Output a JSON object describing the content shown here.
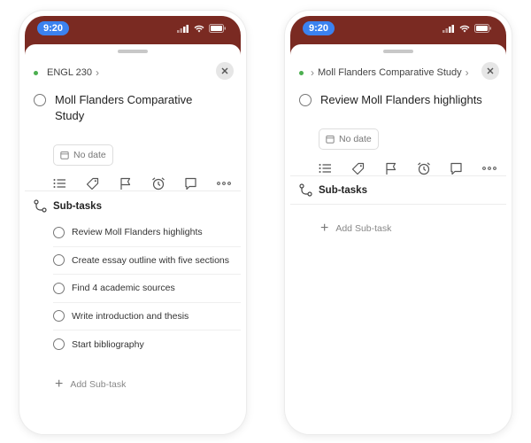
{
  "status_bar": {
    "time": "9:20"
  },
  "left": {
    "breadcrumb": [
      "ENGL 230"
    ],
    "task_title": "Moll Flanders Comparative Study",
    "date_chip": "No date",
    "subtasks_header": "Sub-tasks",
    "subtasks": [
      {
        "label": "Review Moll Flanders highlights"
      },
      {
        "label": "Create essay outline with five sections"
      },
      {
        "label": "Find 4 academic sources"
      },
      {
        "label": "Write introduction and thesis"
      },
      {
        "label": "Start bibliography"
      }
    ],
    "add_subtask": "Add Sub-task"
  },
  "right": {
    "breadcrumb": [
      "Moll Flanders Comparative Study"
    ],
    "task_title": "Review Moll Flanders highlights",
    "date_chip": "No date",
    "subtasks_header": "Sub-tasks",
    "add_subtask": "Add Sub-task"
  },
  "colors": {
    "header": "#7a2a22",
    "time_pill": "#3b82f0",
    "project_dot": "#4caf50"
  },
  "toolbar_icons": [
    "list-icon",
    "tag-icon",
    "flag-icon",
    "alarm-icon",
    "comment-icon",
    "more-icon"
  ]
}
